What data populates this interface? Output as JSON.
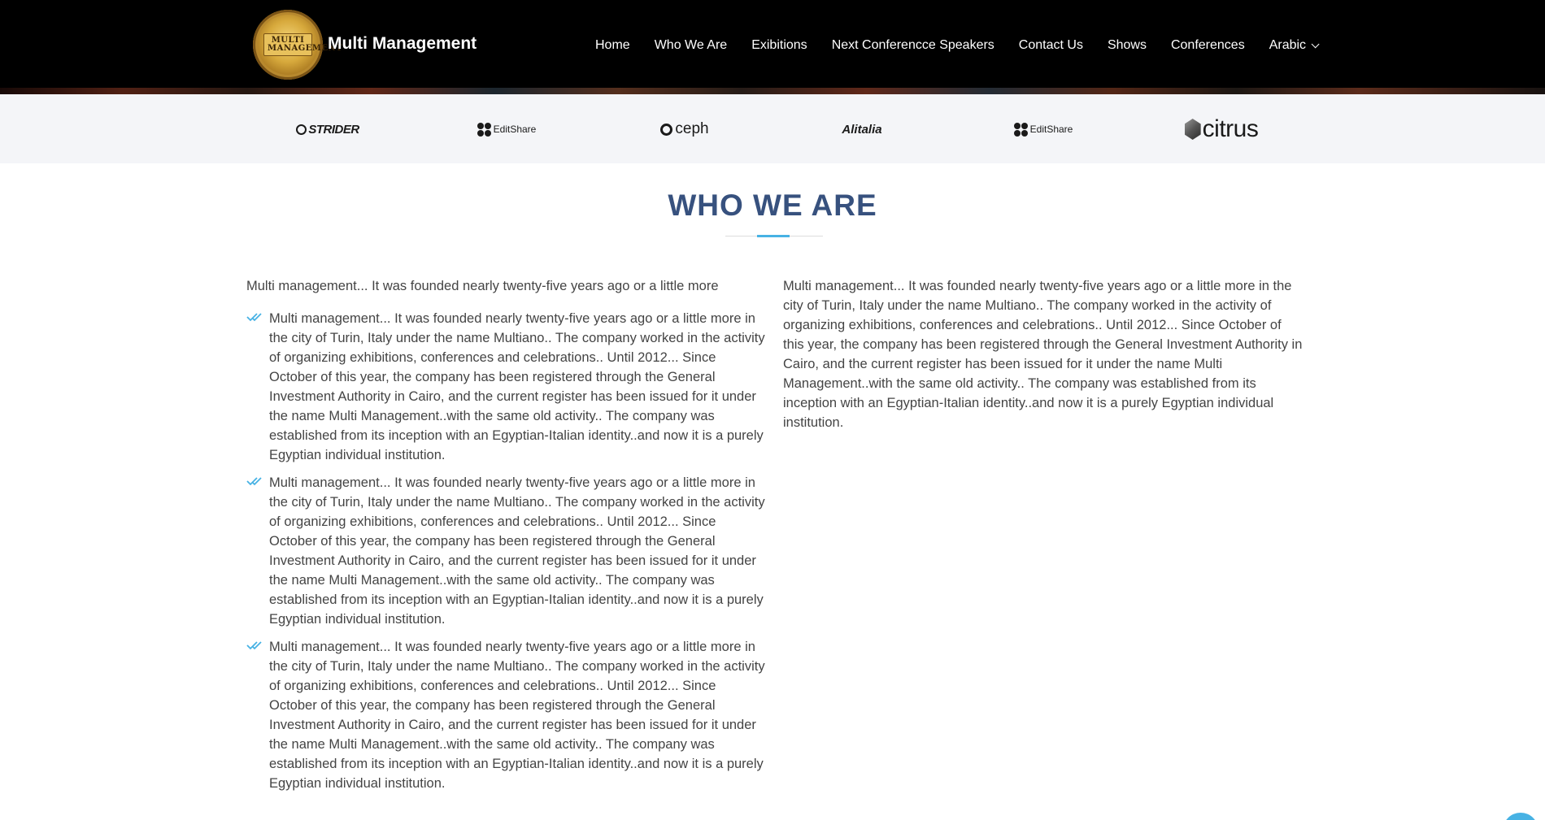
{
  "header": {
    "logo_alt": "MULTI MANAGEMENT",
    "brand": "Multi Management",
    "nav": [
      {
        "label": "Home"
      },
      {
        "label": "Who We Are"
      },
      {
        "label": "Exibitions"
      },
      {
        "label": "Next Conferencce Speakers"
      },
      {
        "label": "Contact Us"
      },
      {
        "label": "Shows"
      },
      {
        "label": "Conferences"
      },
      {
        "label": "Arabic"
      }
    ]
  },
  "clients": {
    "items": [
      {
        "name": "STRIDER",
        "icon": "strider-logo"
      },
      {
        "name": "EditShare",
        "icon": "editshare-logo"
      },
      {
        "name": "ceph",
        "icon": "ceph-logo"
      },
      {
        "name": "Alitalia",
        "icon": "alitalia-logo"
      },
      {
        "name": "EditShare",
        "icon": "editshare-logo"
      },
      {
        "name": "citrus",
        "icon": "citrus-logo"
      }
    ]
  },
  "about": {
    "title": "WHO WE ARE",
    "intro": "Multi management... It was founded nearly twenty-five years ago or a little more",
    "checks": [
      "Multi management... It was founded nearly twenty-five years ago or a little more in the city of Turin, Italy under the name Multiano.. The company worked in the activity of organizing exhibitions, conferences and celebrations.. Until 2012... Since October of this year, the company has been registered through the General Investment Authority in Cairo, and the current register has been issued for it under the name Multi Management..with the same old activity.. The company was established from its inception with an Egyptian-Italian identity..and now it is a purely Egyptian individual institution.",
      "Multi management... It was founded nearly twenty-five years ago or a little more in the city of Turin, Italy under the name Multiano.. The company worked in the activity of organizing exhibitions, conferences and celebrations.. Until 2012... Since October of this year, the company has been registered through the General Investment Authority in Cairo, and the current register has been issued for it under the name Multi Management..with the same old activity.. The company was established from its inception with an Egyptian-Italian identity..and now it is a purely Egyptian individual institution.",
      "Multi management... It was founded nearly twenty-five years ago or a little more in the city of Turin, Italy under the name Multiano.. The company worked in the activity of organizing exhibitions, conferences and celebrations.. Until 2012... Since October of this year, the company has been registered through the General Investment Authority in Cairo, and the current register has been issued for it under the name Multi Management..with the same old activity.. The company was established from its inception with an Egyptian-Italian identity..and now it is a purely Egyptian individual institution."
    ],
    "right_text": "Multi management... It was founded nearly twenty-five years ago or a little more in the city of Turin, Italy under the name Multiano.. The company worked in the activity of organizing exhibitions, conferences and celebrations.. Until 2012... Since October of this year, the company has been registered through the General Investment Authority in Cairo, and the current register has been issued for it under the name Multi Management..with the same old activity.. The company was established from its inception with an Egyptian-Italian identity..and now it is a purely Egyptian individual institution."
  },
  "colors": {
    "header_bg": "#000000",
    "title": "#37517e",
    "accent": "#47b2e4",
    "clients_bg": "#f4f5f8"
  }
}
